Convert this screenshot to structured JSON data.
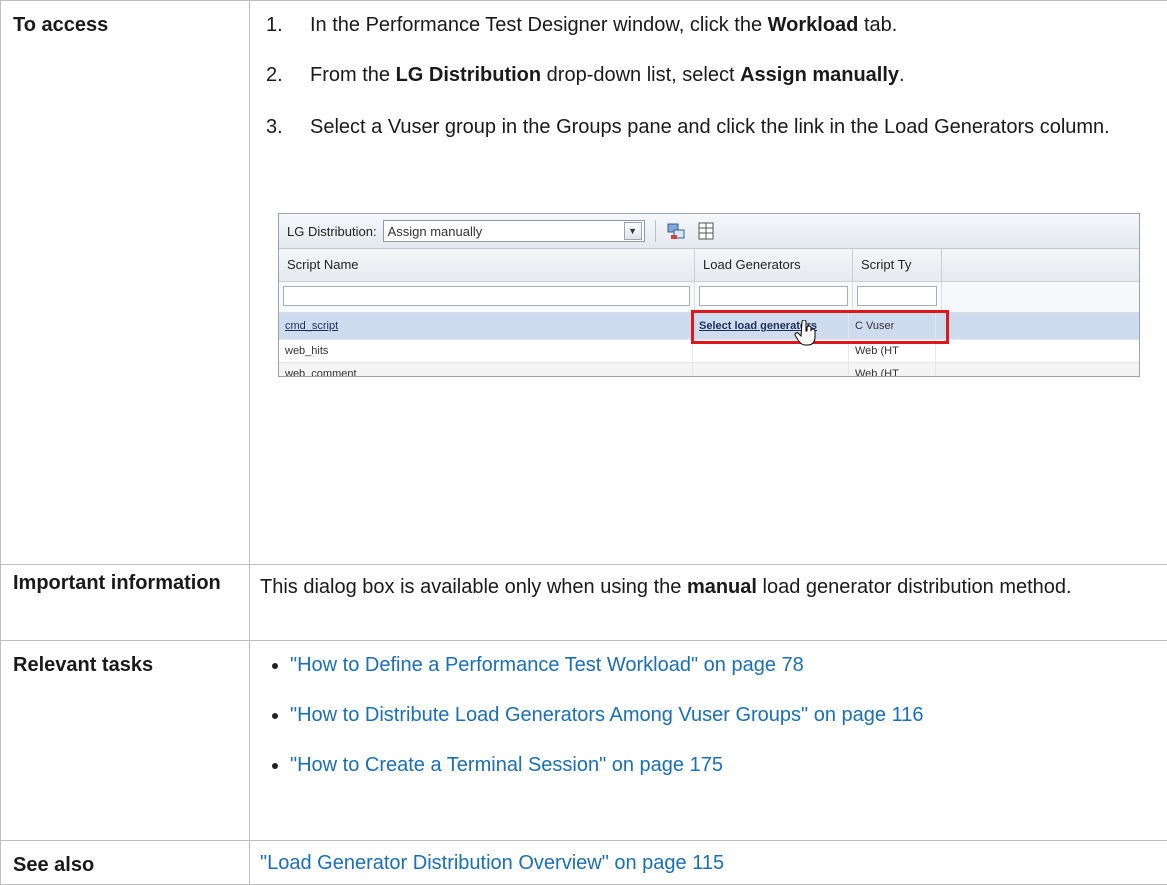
{
  "rows": {
    "access": {
      "label": "To access",
      "steps": [
        {
          "num": "1.",
          "pre": "In the Performance Test Designer window, click the ",
          "bold": "Workload",
          "post": " tab."
        },
        {
          "num": "2.",
          "pre": "From the ",
          "bold": "LG Distribution",
          "mid": " drop-down list, select ",
          "bold2": "Assign manually",
          "post": "."
        },
        {
          "num": "3.",
          "text": "Select a Vuser group in the Groups pane and click the link in the Load Generators column."
        }
      ]
    },
    "important": {
      "label": "Important information",
      "pre": "This dialog box is available only when using the ",
      "bold": "manual",
      "post": " load generator distribution method."
    },
    "tasks": {
      "label": "Relevant tasks",
      "items": [
        "\"How to Define a Performance Test Workload\" on page 78",
        "\"How to Distribute Load Generators Among Vuser Groups\" on page 116",
        "\"How to Create a Terminal Session\" on page 175"
      ]
    },
    "see_also": {
      "label": "See also",
      "link": "\"Load Generator Distribution Overview\" on page 115"
    }
  },
  "screenshot": {
    "lg_distribution_label": "LG Distribution:",
    "lg_distribution_value": "Assign manually",
    "columns": [
      "Script Name",
      "Load Generators",
      "Script Ty"
    ],
    "rows": [
      {
        "script": "cmd_script",
        "lg": "Select load generators",
        "type": "C Vuser"
      },
      {
        "script": "web_hits",
        "lg": "",
        "type": "Web (HT"
      },
      {
        "script": "web_comment",
        "lg": "",
        "type": "Web (HT"
      }
    ]
  },
  "colors": {
    "link": "#1a6fb8",
    "highlight": "#e0161b",
    "selected_row": "#cfdcf0"
  }
}
